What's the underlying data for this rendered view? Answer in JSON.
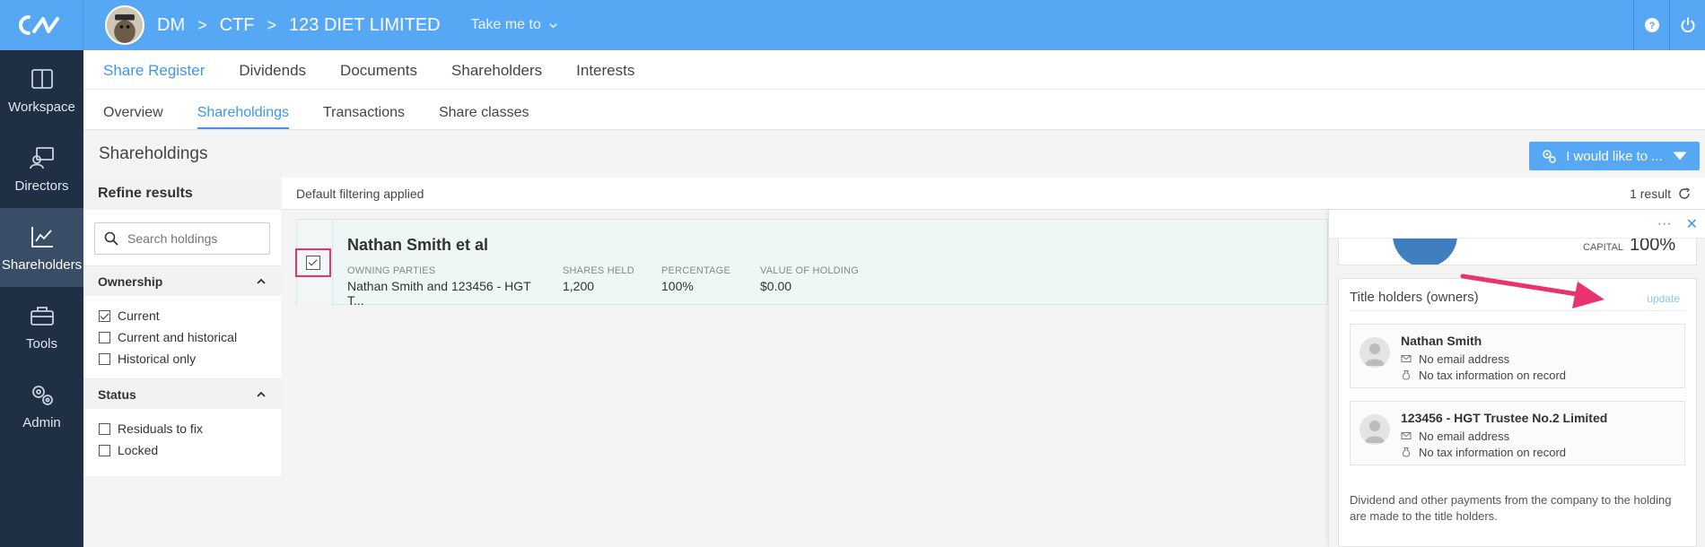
{
  "rail": {
    "items": [
      {
        "label": "Workspace"
      },
      {
        "label": "Directors"
      },
      {
        "label": "Shareholders"
      },
      {
        "label": "Tools"
      },
      {
        "label": "Admin"
      }
    ]
  },
  "topbar": {
    "crumbs": [
      "DM",
      "CTF",
      "123 DIET LIMITED"
    ],
    "take_me": "Take me to"
  },
  "tabs_primary": [
    "Share Register",
    "Dividends",
    "Documents",
    "Shareholders",
    "Interests"
  ],
  "tabs_secondary": [
    "Overview",
    "Shareholdings",
    "Transactions",
    "Share classes"
  ],
  "page": {
    "title": "Shareholdings",
    "action_label": "I would like to ..."
  },
  "filters": {
    "heading": "Refine results",
    "search_placeholder": "Search holdings",
    "ownership": {
      "title": "Ownership",
      "options": [
        "Current",
        "Current and historical",
        "Historical only"
      ]
    },
    "status": {
      "title": "Status",
      "options": [
        "Residuals to fix",
        "Locked"
      ]
    }
  },
  "results": {
    "filter_note": "Default filtering applied",
    "count": "1 result",
    "row": {
      "title": "Nathan Smith et al",
      "owning_label": "OWNING PARTIES",
      "owning_value": "Nathan Smith and 123456 - HGT T...",
      "shares_label": "SHARES HELD",
      "shares_value": "1,200",
      "pct_label": "PERCENTAGE",
      "pct_value": "100%",
      "value_label": "VALUE OF HOLDING",
      "value_value": "$0.00"
    }
  },
  "drawer": {
    "more": "···",
    "close": "✕",
    "capital_label": "CAPITAL",
    "capital_value": "100%",
    "titles_heading": "Title holders (owners)",
    "update": "update",
    "owners": [
      {
        "name": "Nathan Smith",
        "email": "No email address",
        "tax": "No tax information on record"
      },
      {
        "name": "123456 - HGT Trustee No.2 Limited",
        "email": "No email address",
        "tax": "No tax information on record"
      }
    ],
    "note": "Dividend and other payments from the company to the holding are made to the title holders."
  },
  "colors": {
    "brand": "#56a8f5",
    "rail": "#1f2f44",
    "accent": "#3f97e8",
    "annotation": "#e8336f"
  }
}
